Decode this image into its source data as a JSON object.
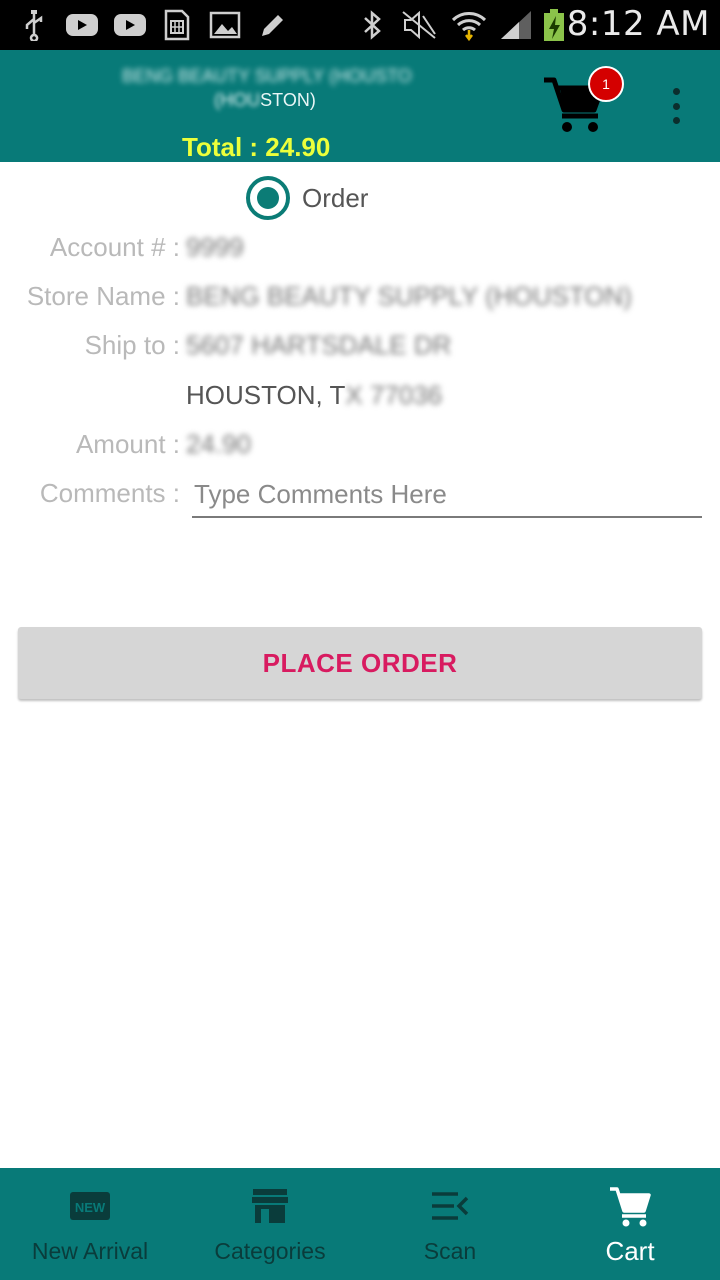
{
  "status_bar": {
    "time": "8:12 AM",
    "icons": [
      "usb-icon",
      "youtube-icon",
      "youtube-icon",
      "sim-card-icon",
      "image-icon",
      "pencil-icon",
      "bluetooth-icon",
      "mute-icon",
      "wifi-icon",
      "signal-icon",
      "battery-charging-icon"
    ]
  },
  "header": {
    "store_name": "BENG BEAUTY SUPPLY (HOUSTON)",
    "subtitle_prefix": "(HOU",
    "subtitle_suffix": "STON)",
    "total": "Total : 24.90",
    "cart_count": "1",
    "colors": {
      "bar": "#087a78",
      "total": "#ecff3b",
      "badge": "#d40000"
    }
  },
  "form": {
    "radio_label": "Order",
    "account_label": "Account # :",
    "account_value": "9999",
    "store_label": "Store Name :",
    "store_value": "BENG BEAUTY SUPPLY (HOUSTON)",
    "ship_label": "Ship to :",
    "ship_value": "5607 HARTSDALE DR",
    "city_prefix": "HOUSTON,  T",
    "city_blurred": "X 77036",
    "amount_label": "Amount :",
    "amount_value": "24.90",
    "comments_label": "Comments :",
    "comments_placeholder": "Type Comments Here",
    "comments_value": ""
  },
  "actions": {
    "place_order": "PLACE ORDER",
    "accent": "#d81b60"
  },
  "bottom_nav": {
    "new_arrival": "New Arrival",
    "categories": "Categories",
    "scan": "Scan",
    "cart": "Cart",
    "active": "cart"
  }
}
